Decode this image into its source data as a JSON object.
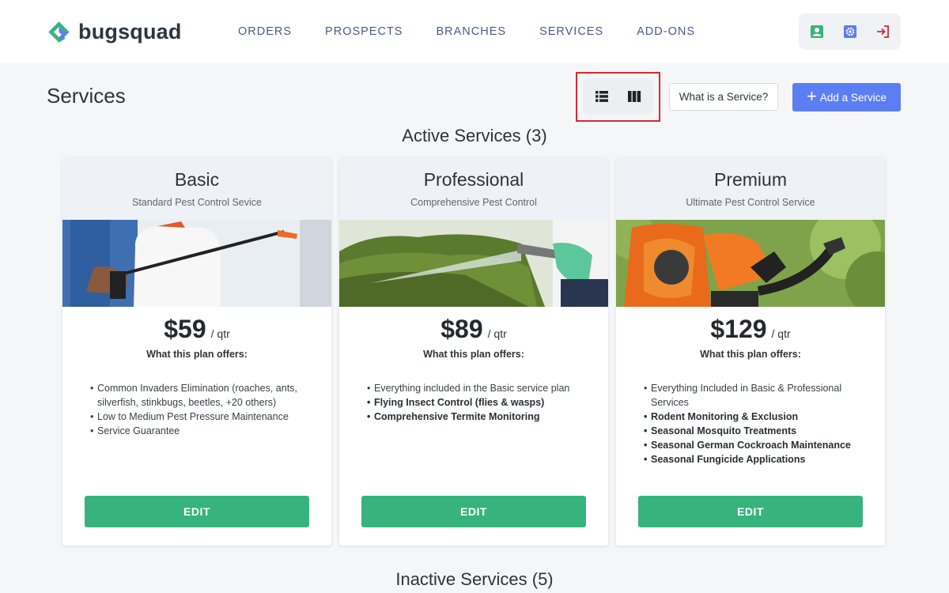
{
  "brand": {
    "name": "bugsquad"
  },
  "nav": [
    {
      "label": "ORDERS"
    },
    {
      "label": "PROSPECTS"
    },
    {
      "label": "BRANCHES"
    },
    {
      "label": "SERVICES"
    },
    {
      "label": "ADD-ONS"
    }
  ],
  "toolbar_icons": [
    "user-card-icon",
    "gear-icon",
    "logout-icon"
  ],
  "page": {
    "title": "Services",
    "what_button": "What is a Service?",
    "add_button": "Add a Service",
    "view_icons": [
      "list-view-icon",
      "column-view-icon"
    ]
  },
  "sections": {
    "active": "Active Services (3)",
    "inactive": "Inactive Services (5)"
  },
  "offers_label": "What this plan offers:",
  "edit_label": "EDIT",
  "colors": {
    "accent": "#5b7ff3",
    "success": "#37b47e",
    "highlight": "#d9262e"
  },
  "services": [
    {
      "name": "Basic",
      "subtitle": "Standard Pest Control Sevice",
      "price": "$59",
      "unit": "/ qtr",
      "features": [
        {
          "text": "Common Invaders Elimination (roaches, ants, silverfish, stinkbugs, beetles, +20 others)",
          "bold": false
        },
        {
          "text": "Low to Medium Pest Pressure Maintenance",
          "bold": false
        },
        {
          "text": "Service Guarantee",
          "bold": false
        }
      ]
    },
    {
      "name": "Professional",
      "subtitle": "Comprehensive Pest Control",
      "price": "$89",
      "unit": "/ qtr",
      "features": [
        {
          "text": "Everything included in the Basic service plan",
          "bold": false
        },
        {
          "text": "Flying Insect Control (flies & wasps)",
          "bold": true
        },
        {
          "text": "Comprehensive Termite Monitoring",
          "bold": true
        }
      ]
    },
    {
      "name": "Premium",
      "subtitle": "Ultimate Pest Control Service",
      "price": "$129",
      "unit": "/ qtr",
      "features": [
        {
          "text": "Everything Included in Basic & Professional Services",
          "bold": false
        },
        {
          "text": "Rodent Monitoring & Exclusion",
          "bold": true
        },
        {
          "text": "Seasonal Mosquito Treatments",
          "bold": true
        },
        {
          "text": "Seasonal German Cockroach Maintenance",
          "bold": true
        },
        {
          "text": "Seasonal Fungicide Applications",
          "bold": true
        }
      ]
    }
  ]
}
